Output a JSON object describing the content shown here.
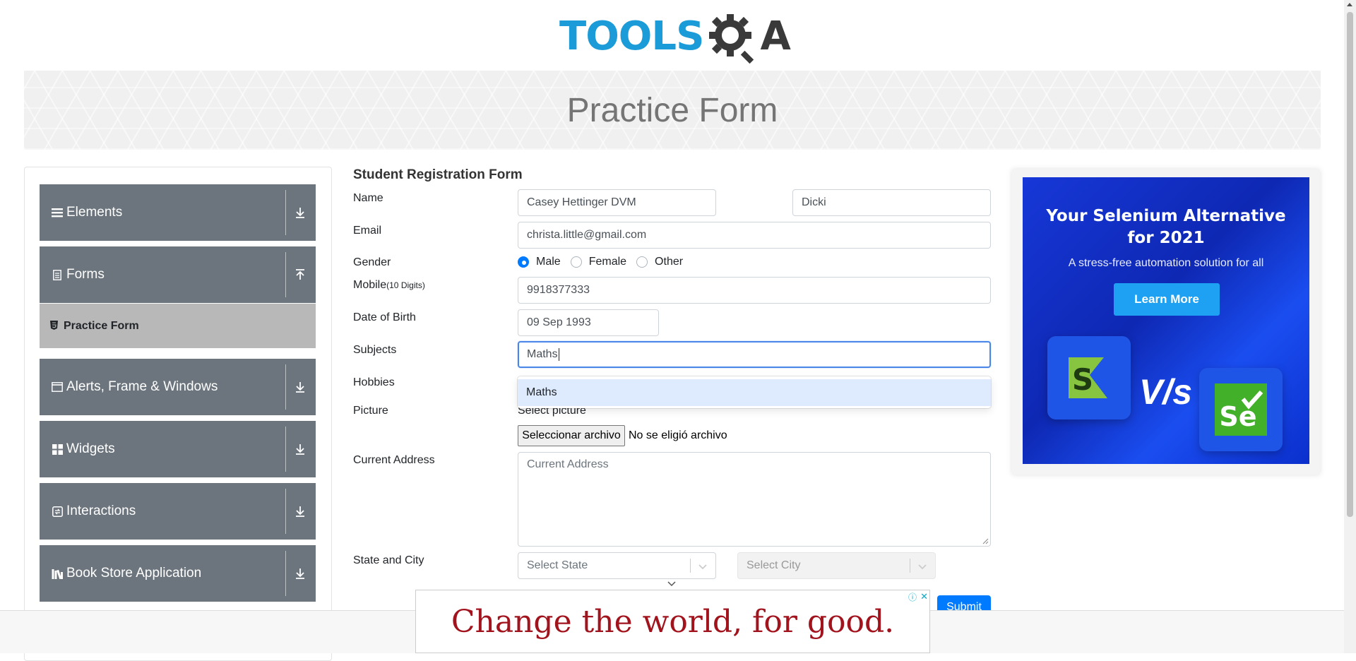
{
  "header": {
    "logo_text_left": "TOOLS",
    "logo_text_right": "A",
    "banner_title": "Practice Form"
  },
  "sidebar": {
    "groups": [
      {
        "label": "Elements",
        "icon": "hamburger-icon",
        "arrow": "download-arrow-icon"
      },
      {
        "label": "Forms",
        "icon": "document-icon",
        "arrow": "upload-arrow-icon"
      },
      {
        "label": "Alerts, Frame & Windows",
        "icon": "window-icon",
        "arrow": "download-arrow-icon"
      },
      {
        "label": "Widgets",
        "icon": "grid-icon",
        "arrow": "download-arrow-icon"
      },
      {
        "label": "Interactions",
        "icon": "interaction-icon",
        "arrow": "download-arrow-icon"
      },
      {
        "label": "Book Store Application",
        "icon": "books-icon",
        "arrow": "download-arrow-icon"
      }
    ],
    "active_item": {
      "label": "Practice Form",
      "icon": "html-icon"
    }
  },
  "form": {
    "title": "Student Registration Form",
    "name_label": "Name",
    "first_name": "Casey Hettinger DVM",
    "last_name": "Dicki",
    "email_label": "Email",
    "email": "christa.little@gmail.com",
    "gender_label": "Gender",
    "gender_options": [
      "Male",
      "Female",
      "Other"
    ],
    "gender_selected": "Male",
    "mobile_label": "Mobile",
    "mobile_hint": "(10 Digits)",
    "mobile": "9918377333",
    "dob_label": "Date of Birth",
    "dob": "09 Sep 1993",
    "subjects_label": "Subjects",
    "subjects_value": "Maths",
    "subjects_suggestion": "Maths",
    "hobbies_label": "Hobbies",
    "picture_label": "Picture",
    "picture_hint": "Select picture",
    "file_button": "Seleccionar archivo",
    "file_status": "No se eligió archivo",
    "address_label": "Current Address",
    "address_placeholder": "Current Address",
    "state_city_label": "State and City",
    "state_placeholder": "Select State",
    "city_placeholder": "Select City",
    "submit": "Submit"
  },
  "ad_right": {
    "title_line1": "Your Selenium Alternative",
    "title_line2": "for 2021",
    "subtitle": "A stress-free automation solution for all",
    "button": "Learn More",
    "vs": "V/s",
    "logo_left_letter": "S",
    "logo_right_letter": "Se"
  },
  "ad_bottom": {
    "text": "Change the world, for good.",
    "close": "✕",
    "info": "ⓘ"
  },
  "colors": {
    "brand_blue": "#1b9bd7",
    "sidebar_group": "#6c757d",
    "active_item": "#b8b8b8",
    "primary": "#007bff",
    "ad_red": "#a1131d"
  }
}
